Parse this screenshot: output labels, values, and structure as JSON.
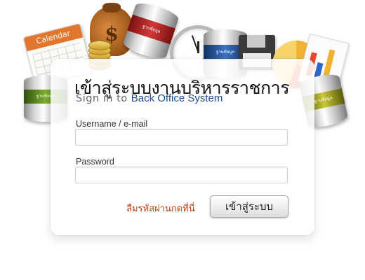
{
  "decor": {
    "calendar_label": "Calendar",
    "money_sign": "$",
    "cylinder_red_label": "ฐานข้อมูล",
    "cylinder_blue_label": "ฐานข้อมูล",
    "cylinder_green_label": "ฐานข้อมูล",
    "cylinder_yellow_label": "ฐานข้อมูล"
  },
  "login": {
    "title": "เข้าสู่ระบบงานบริหารราชการ",
    "subtitle_prefix": "Sign in to ",
    "subtitle_brand": "Back Office System",
    "username_label": "Username / e-mail",
    "username_value": "",
    "password_label": "Password",
    "password_value": "",
    "forgot_link": "ลืมรหัสผ่านกดที่นี่",
    "submit_label": "เข้าสู่ระบบ"
  },
  "colors": {
    "brand_blue": "#1b4f8f",
    "link_red": "#c0401a"
  }
}
